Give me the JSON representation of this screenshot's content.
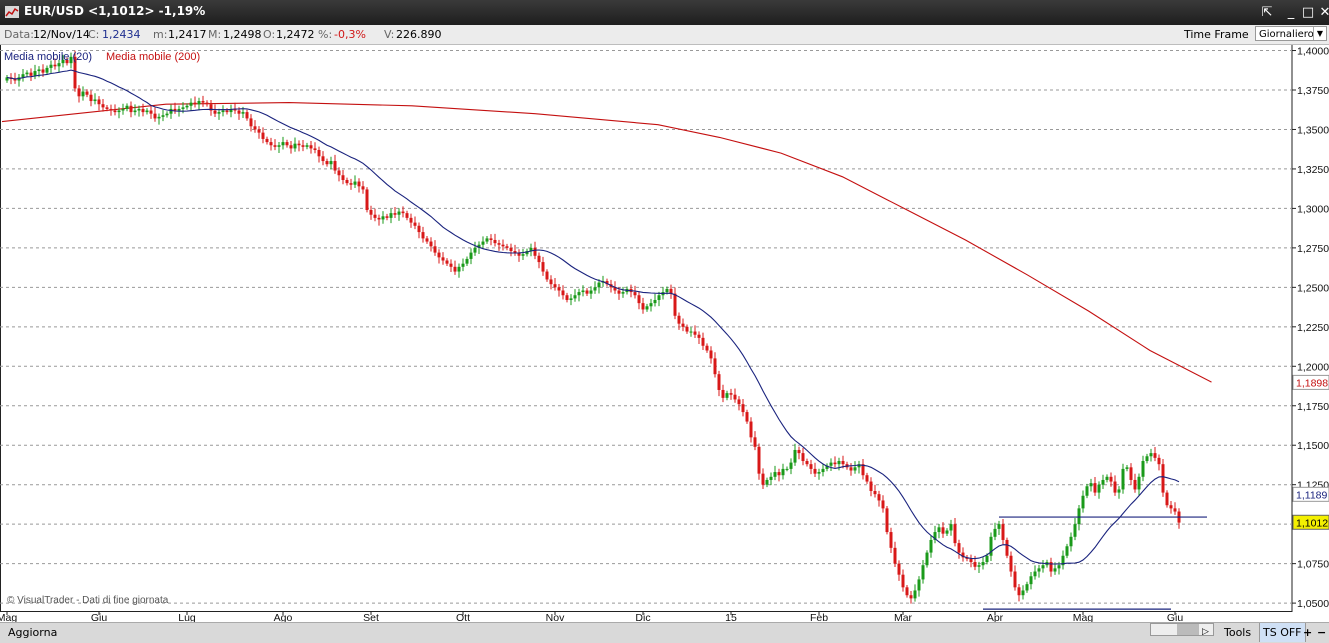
{
  "window": {
    "title": "EUR/USD <1,1012> -1,19%",
    "buttons": [
      "⇱",
      "_",
      "□",
      "✕"
    ]
  },
  "info_bar": {
    "date_label": "Data:",
    "date_value": "12/Nov/14",
    "close_label": "C:",
    "close_value": "1,2434",
    "min_label": "m:",
    "min_value": "1,2417",
    "max_label": "M:",
    "max_value": "1,2498",
    "open_label": "O:",
    "open_value": "1,2472",
    "pct_label": "%:",
    "pct_value": "-0,3%",
    "vol_label": "V:",
    "vol_value": "226.890",
    "time_frame_label": "Time Frame",
    "time_frame_value": "Giornaliero"
  },
  "legend": {
    "ma20": "Media mobile (20)",
    "ma200": "Media mobile (200)"
  },
  "watermark": "© VisualTrader - Dati di fine giornata",
  "bottom_bar": {
    "refresh_label": "Aggiorna",
    "tools_label": "Tools",
    "ts_label": "TS OFF",
    "plus": "+",
    "minus": "−"
  },
  "colors": {
    "up_candle": "#1a9a1a",
    "down_candle": "#d81818",
    "ma20": "#1a237e",
    "ma200": "#c41010",
    "grid": "#999999",
    "last_price_bg": "#f4f000",
    "ma20_label_color": "#1a237e",
    "ma200_label_color": "#c41010"
  },
  "chart_data": {
    "type": "candlestick",
    "instrument": "EUR/USD",
    "last_price": "1,1012",
    "change_pct": "-1,19%",
    "y_ticks": [
      "1,4000",
      "1,3750",
      "1,3500",
      "1,3250",
      "1,3000",
      "1,2750",
      "1,2500",
      "1,2250",
      "1,2000",
      "1,1750",
      "1,1500",
      "1,1250",
      "1,1000",
      "1,0750",
      "1,0500"
    ],
    "y_range": [
      1.045,
      1.4035
    ],
    "x_ticks": [
      "Mag",
      "Giu",
      "Lug",
      "Ago",
      "Set",
      "Ott",
      "Nov",
      "Dic",
      "15",
      "Feb",
      "Mar",
      "Apr",
      "Mag",
      "Giu"
    ],
    "x_tick_index": [
      0,
      23,
      45,
      69,
      91,
      114,
      137,
      159,
      181,
      203,
      224,
      247,
      269,
      292
    ],
    "grid": true,
    "price_tags": [
      {
        "value": 1.1898,
        "label": "1,1898",
        "series": "ma200"
      },
      {
        "value": 1.1189,
        "label": "1,1189",
        "series": "ma20"
      },
      {
        "value": 1.1012,
        "label": "1,1012",
        "series": "last"
      }
    ],
    "closes": [
      1.383,
      1.382,
      1.381,
      1.383,
      1.385,
      1.386,
      1.384,
      1.387,
      1.388,
      1.386,
      1.389,
      1.391,
      1.39,
      1.392,
      1.394,
      1.392,
      1.396,
      1.376,
      1.371,
      1.374,
      1.372,
      1.368,
      1.369,
      1.366,
      1.364,
      1.363,
      1.362,
      1.361,
      1.362,
      1.363,
      1.365,
      1.361,
      1.362,
      1.363,
      1.361,
      1.362,
      1.36,
      1.357,
      1.358,
      1.359,
      1.36,
      1.363,
      1.362,
      1.363,
      1.364,
      1.365,
      1.367,
      1.366,
      1.368,
      1.367,
      1.366,
      1.362,
      1.36,
      1.361,
      1.362,
      1.361,
      1.363,
      1.362,
      1.36,
      1.361,
      1.357,
      1.352,
      1.35,
      1.348,
      1.344,
      1.342,
      1.34,
      1.339,
      1.34,
      1.342,
      1.34,
      1.338,
      1.341,
      1.34,
      1.339,
      1.34,
      1.338,
      1.337,
      1.333,
      1.33,
      1.328,
      1.33,
      1.324,
      1.321,
      1.318,
      1.316,
      1.315,
      1.317,
      1.314,
      1.312,
      1.299,
      1.296,
      1.294,
      1.293,
      1.295,
      1.294,
      1.297,
      1.296,
      1.298,
      1.297,
      1.294,
      1.291,
      1.289,
      1.285,
      1.281,
      1.279,
      1.276,
      1.272,
      1.269,
      1.267,
      1.265,
      1.263,
      1.26,
      1.263,
      1.265,
      1.268,
      1.272,
      1.275,
      1.277,
      1.279,
      1.281,
      1.28,
      1.278,
      1.277,
      1.276,
      1.275,
      1.273,
      1.272,
      1.27,
      1.271,
      1.273,
      1.275,
      1.27,
      1.266,
      1.26,
      1.255,
      1.252,
      1.25,
      1.248,
      1.245,
      1.242,
      1.243,
      1.245,
      1.247,
      1.248,
      1.246,
      1.248,
      1.25,
      1.253,
      1.254,
      1.252,
      1.25,
      1.248,
      1.246,
      1.247,
      1.249,
      1.247,
      1.245,
      1.24,
      1.236,
      1.238,
      1.24,
      1.242,
      1.245,
      1.247,
      1.249,
      1.246,
      1.232,
      1.227,
      1.225,
      1.222,
      1.222,
      1.22,
      1.218,
      1.213,
      1.21,
      1.205,
      1.195,
      1.185,
      1.18,
      1.183,
      1.182,
      1.179,
      1.176,
      1.171,
      1.165,
      1.155,
      1.149,
      1.132,
      1.125,
      1.128,
      1.13,
      1.133,
      1.131,
      1.135,
      1.135,
      1.139,
      1.147,
      1.145,
      1.14,
      1.138,
      1.135,
      1.132,
      1.133,
      1.135,
      1.137,
      1.139,
      1.138,
      1.14,
      1.138,
      1.136,
      1.134,
      1.136,
      1.138,
      1.131,
      1.127,
      1.121,
      1.119,
      1.115,
      1.11,
      1.095,
      1.085,
      1.075,
      1.068,
      1.06,
      1.055,
      1.053,
      1.058,
      1.065,
      1.074,
      1.082,
      1.09,
      1.095,
      1.098,
      1.094,
      1.096,
      1.1,
      1.088,
      1.082,
      1.079,
      1.078,
      1.076,
      1.073,
      1.074,
      1.076,
      1.08,
      1.092,
      1.097,
      1.1,
      1.09,
      1.08,
      1.07,
      1.06,
      1.055,
      1.058,
      1.062,
      1.067,
      1.07,
      1.072,
      1.074,
      1.076,
      1.07,
      1.072,
      1.074,
      1.08,
      1.086,
      1.092,
      1.1,
      1.11,
      1.118,
      1.124,
      1.126,
      1.12,
      1.125,
      1.128,
      1.13,
      1.127,
      1.12,
      1.122,
      1.135,
      1.136,
      1.128,
      1.122,
      1.13,
      1.14,
      1.143,
      1.145,
      1.142,
      1.138,
      1.12,
      1.112,
      1.11,
      1.108,
      1.101
    ]
  }
}
